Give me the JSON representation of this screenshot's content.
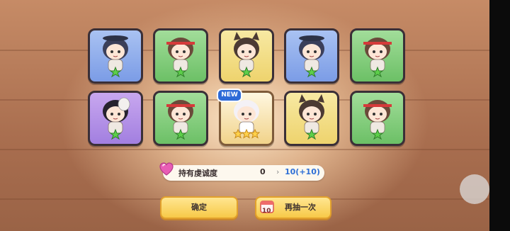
{
  "cards": [
    {
      "color": "blue",
      "character": "dark-hair-hat-chibi",
      "stars": 1
    },
    {
      "color": "green",
      "character": "headband-chibi",
      "stars": 1
    },
    {
      "color": "yellow",
      "character": "wolf-ear-chibi",
      "stars": 1
    },
    {
      "color": "blue",
      "character": "dark-hair-hat-chibi",
      "stars": 1
    },
    {
      "color": "green",
      "character": "headband-chibi",
      "stars": 1
    },
    {
      "color": "purple",
      "character": "skull-mask-chibi",
      "stars": 1
    },
    {
      "color": "green",
      "character": "headband-chibi",
      "stars": 1
    },
    {
      "color": "gold",
      "character": "white-hair-chibi",
      "stars": 3,
      "is_new": true
    },
    {
      "color": "yellow",
      "character": "wolf-ear-chibi",
      "stars": 1
    },
    {
      "color": "green",
      "character": "headband-chibi",
      "stars": 1
    }
  ],
  "new_badge": "NEW",
  "stat": {
    "label": "持有虔诚度",
    "old_value": "0",
    "arrow": "›",
    "new_value": "10(+10)"
  },
  "buttons": {
    "confirm": "确定",
    "draw_again": "再抽一次",
    "ticket_count": "10"
  },
  "colors": {
    "blue": "#8aa8ec",
    "green": "#7fcb78",
    "yellow": "#f1dc85",
    "purple": "#b18ee6",
    "gold": "#f6e2b0",
    "button": "#f7c948",
    "value_blue": "#2e6fd6"
  }
}
